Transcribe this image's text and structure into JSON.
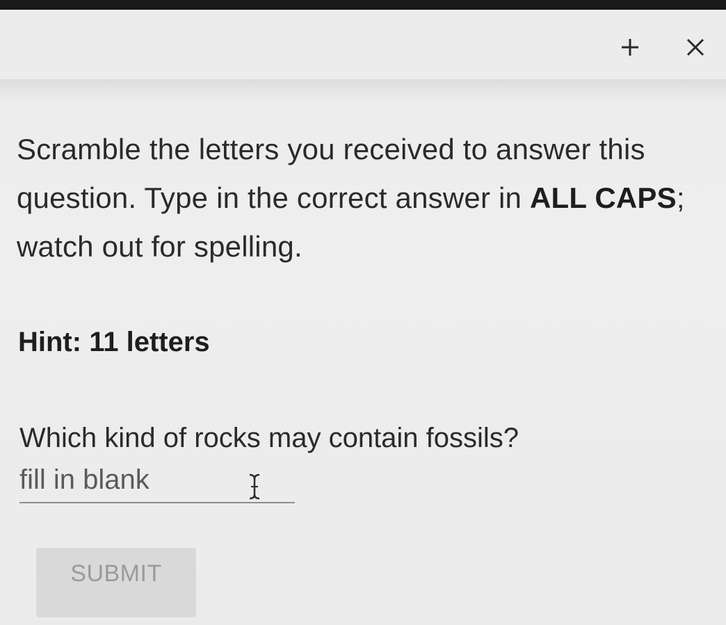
{
  "dialog": {
    "controls": {
      "add_icon": "plus-icon",
      "close_icon": "close-icon"
    }
  },
  "instructions": {
    "part1": "Scramble the letters you received to answer this question. Type in the correct answer in ",
    "emphasis": "ALL CAPS",
    "part2": "; watch out for spelling."
  },
  "hint": "Hint: 11 letters",
  "question": "Which kind of rocks may contain fossils?",
  "answer": {
    "value": "",
    "placeholder": "fill in blank"
  },
  "submit": {
    "label": "SUBMIT",
    "enabled": false
  },
  "colors": {
    "background": "#ececec",
    "text": "#2a2a2a",
    "button_disabled_bg": "#d9d9d9",
    "button_disabled_text": "#9a9a9a"
  }
}
